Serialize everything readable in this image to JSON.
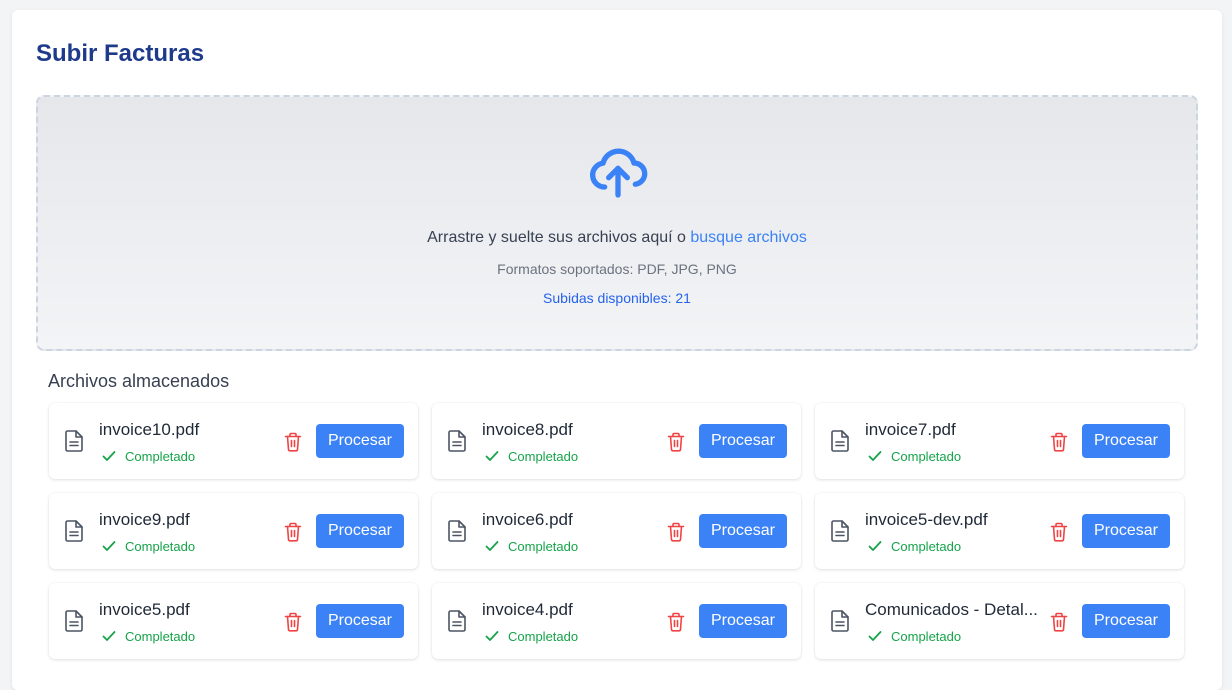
{
  "page": {
    "title": "Subir Facturas"
  },
  "dropzone": {
    "text_before": "Arrastre y suelte sus archivos aquí o",
    "browse_link": "busque archivos",
    "formats": "Formatos soportados: PDF, JPG, PNG",
    "uploads_available": "Subidas disponibles: 21"
  },
  "files_section": {
    "label": "Archivos almacenados",
    "process_label": "Procesar",
    "files": [
      {
        "name": "invoice10.pdf",
        "status": "Completado"
      },
      {
        "name": "invoice8.pdf",
        "status": "Completado"
      },
      {
        "name": "invoice7.pdf",
        "status": "Completado"
      },
      {
        "name": "invoice9.pdf",
        "status": "Completado"
      },
      {
        "name": "invoice6.pdf",
        "status": "Completado"
      },
      {
        "name": "invoice5-dev.pdf",
        "status": "Completado"
      },
      {
        "name": "invoice5.pdf",
        "status": "Completado"
      },
      {
        "name": "invoice4.pdf",
        "status": "Completado"
      },
      {
        "name": "Comunicados - Detal...",
        "status": "Completado"
      }
    ]
  },
  "colors": {
    "title": "#1e3a8a",
    "accent": "#3b82f6",
    "success": "#16a34a",
    "danger": "#ef4444"
  },
  "icons": {
    "upload": "cloud-upload-icon",
    "file": "file-text-icon",
    "status": "check-icon",
    "delete": "trash-icon"
  }
}
